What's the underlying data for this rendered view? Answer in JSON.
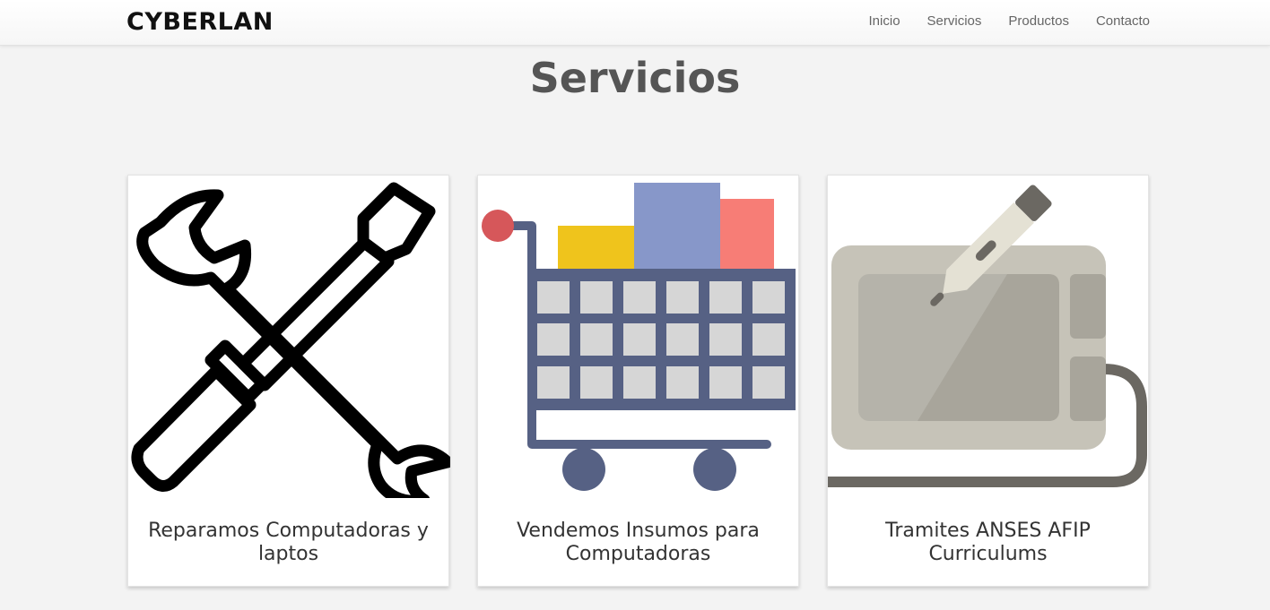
{
  "navbar": {
    "brand": "CYBERLAN",
    "links": [
      {
        "label": "Inicio"
      },
      {
        "label": "Servicios"
      },
      {
        "label": "Productos"
      },
      {
        "label": "Contacto"
      }
    ]
  },
  "main": {
    "title": "Servicios",
    "cards": [
      {
        "title": "Reparamos Computadoras y laptos",
        "icon": "tools-icon"
      },
      {
        "title": "Vendemos Insumos para Computadoras",
        "icon": "shopping-cart-icon"
      },
      {
        "title": "Tramites ANSES AFIP Curriculums",
        "icon": "graphics-tablet-icon"
      }
    ]
  }
}
